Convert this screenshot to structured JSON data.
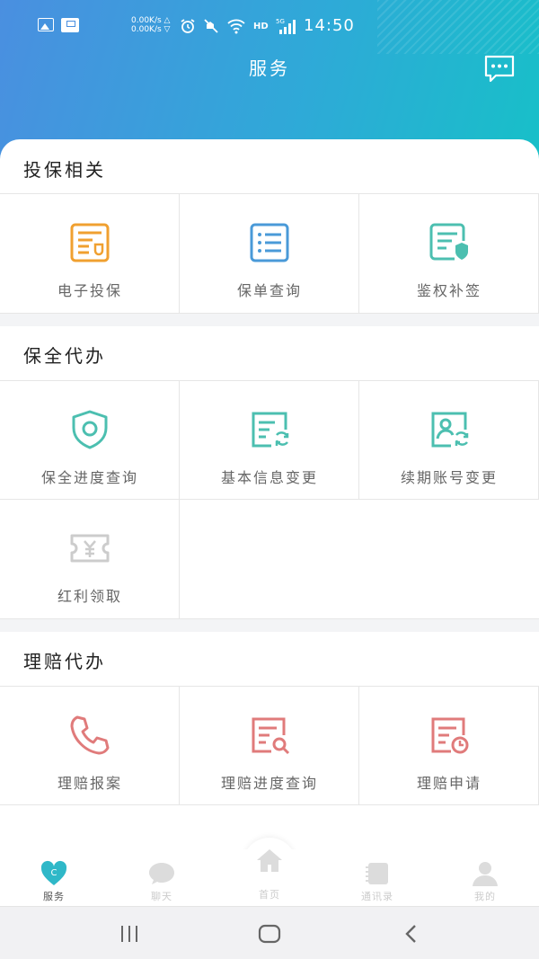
{
  "status_bar": {
    "speed_up": "0.00K/s",
    "speed_down": "0.00K/s",
    "network_hd": "HD",
    "network_type": "5G",
    "time": "14:50"
  },
  "header": {
    "title": "服务"
  },
  "sections": [
    {
      "title": "投保相关",
      "items": [
        {
          "label": "电子投保",
          "icon": "e-policy-icon",
          "color": "#f0a030"
        },
        {
          "label": "保单查询",
          "icon": "policy-list-icon",
          "color": "#4a9ad8"
        },
        {
          "label": "鉴权补签",
          "icon": "auth-resign-icon",
          "color": "#4cbfb0"
        }
      ]
    },
    {
      "title": "保全代办",
      "items": [
        {
          "label": "保全进度查询",
          "icon": "shield-icon",
          "color": "#4cbfb0"
        },
        {
          "label": "基本信息变更",
          "icon": "info-change-icon",
          "color": "#4cbfb0"
        },
        {
          "label": "续期账号变更",
          "icon": "account-change-icon",
          "color": "#4cbfb0"
        },
        {
          "label": "红利领取",
          "icon": "dividend-ticket-icon",
          "color": "#cccccc"
        }
      ]
    },
    {
      "title": "理赔代办",
      "items": [
        {
          "label": "理赔报案",
          "icon": "phone-icon",
          "color": "#e07b7b"
        },
        {
          "label": "理赔进度查询",
          "icon": "claim-search-icon",
          "color": "#e07b7b"
        },
        {
          "label": "理赔申请",
          "icon": "claim-apply-icon",
          "color": "#e07b7b"
        }
      ]
    }
  ],
  "tabbar": [
    {
      "label": "服务",
      "icon": "service-heart-icon",
      "active": true
    },
    {
      "label": "聊天",
      "icon": "chat-bubble-icon",
      "active": false
    },
    {
      "label": "首页",
      "icon": "home-icon",
      "active": false
    },
    {
      "label": "通讯录",
      "icon": "contacts-book-icon",
      "active": false
    },
    {
      "label": "我的",
      "icon": "profile-icon",
      "active": false
    }
  ],
  "colors": {
    "header_start": "#4a8fe0",
    "header_end": "#17c0c8",
    "active_tab": "#2fb8c8"
  }
}
